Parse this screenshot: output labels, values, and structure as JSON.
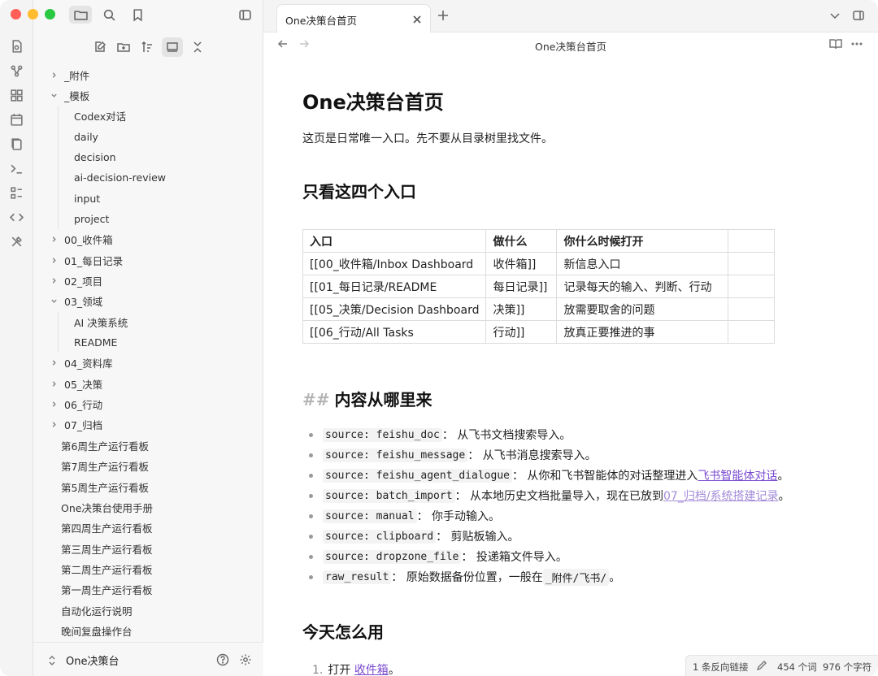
{
  "sidebar": {
    "tree": [
      {
        "label": "_附件",
        "kind": "folder",
        "expanded": false
      },
      {
        "label": "_模板",
        "kind": "folder",
        "expanded": true
      },
      {
        "label": "Codex对话",
        "kind": "file",
        "depth": 1
      },
      {
        "label": "daily",
        "kind": "file",
        "depth": 1
      },
      {
        "label": "decision",
        "kind": "file",
        "depth": 1
      },
      {
        "label": "ai-decision-review",
        "kind": "file",
        "depth": 1
      },
      {
        "label": "input",
        "kind": "file",
        "depth": 1
      },
      {
        "label": "project",
        "kind": "file",
        "depth": 1
      },
      {
        "label": "00_收件箱",
        "kind": "folder",
        "expanded": false
      },
      {
        "label": "01_每日记录",
        "kind": "folder",
        "expanded": false
      },
      {
        "label": "02_项目",
        "kind": "folder",
        "expanded": false
      },
      {
        "label": "03_领域",
        "kind": "folder",
        "expanded": true
      },
      {
        "label": "AI 决策系统",
        "kind": "file",
        "depth": 1
      },
      {
        "label": "README",
        "kind": "file",
        "depth": 1
      },
      {
        "label": "04_资料库",
        "kind": "folder",
        "expanded": false
      },
      {
        "label": "05_决策",
        "kind": "folder",
        "expanded": false
      },
      {
        "label": "06_行动",
        "kind": "folder",
        "expanded": false
      },
      {
        "label": "07_归档",
        "kind": "folder",
        "expanded": false
      },
      {
        "label": "第6周生产运行看板",
        "kind": "file",
        "depth": 0
      },
      {
        "label": "第7周生产运行看板",
        "kind": "file",
        "depth": 0
      },
      {
        "label": "第5周生产运行看板",
        "kind": "file",
        "depth": 0
      },
      {
        "label": "One决策台使用手册",
        "kind": "file",
        "depth": 0
      },
      {
        "label": "第四周生产运行看板",
        "kind": "file",
        "depth": 0
      },
      {
        "label": "第三周生产运行看板",
        "kind": "file",
        "depth": 0
      },
      {
        "label": "第二周生产运行看板",
        "kind": "file",
        "depth": 0
      },
      {
        "label": "第一周生产运行看板",
        "kind": "file",
        "depth": 0
      },
      {
        "label": "自动化运行说明",
        "kind": "file",
        "depth": 0
      },
      {
        "label": "晚间复盘操作台",
        "kind": "file",
        "depth": 0
      }
    ],
    "vault_name": "One决策台"
  },
  "tabs": [
    {
      "label": "One决策台首页",
      "active": true
    }
  ],
  "nav": {
    "title": "One决策台首页"
  },
  "doc": {
    "title": "One决策台首页",
    "intro": "这页是日常唯一入口。先不要从目录树里找文件。",
    "h_entries": "只看这四个入口",
    "table": {
      "headers": [
        "入口",
        "做什么",
        "你什么时候打开",
        ""
      ],
      "rows": [
        [
          "[[00_收件箱/Inbox Dashboard",
          "收件箱]]",
          "新信息入口",
          ""
        ],
        [
          "[[01_每日记录/README",
          "每日记录]]",
          "记录每天的输入、判断、行动",
          ""
        ],
        [
          "[[05_决策/Decision Dashboard",
          "决策]]",
          "放需要取舍的问题",
          ""
        ],
        [
          "[[06_行动/All Tasks",
          "行动]]",
          "放真正要推进的事",
          ""
        ]
      ]
    },
    "h_source_hashes": "##",
    "h_source": "内容从哪里来",
    "bullets": [
      {
        "code": "source: feishu_doc",
        "text": "： 从飞书文档搜索导入。"
      },
      {
        "code": "source: feishu_message",
        "text": "： 从飞书消息搜索导入。"
      },
      {
        "code": "source: feishu_agent_dialogue",
        "text": "： 从你和飞书智能体的对话整理进入 ",
        "link": "飞书智能体对话",
        "link_style": "strong",
        "tail": "。"
      },
      {
        "code": "source: batch_import",
        "text": "： 从本地历史文档批量导入，现在已放到 ",
        "link": "07_归档/系统搭建记录",
        "link_style": "faint",
        "tail": "。"
      },
      {
        "code": "source: manual",
        "text": "： 你手动输入。"
      },
      {
        "code": "source: clipboard",
        "text": "： 剪贴板输入。"
      },
      {
        "code": "source: dropzone_file",
        "text": "： 投递箱文件导入。"
      },
      {
        "code": "raw_result",
        "text": "： 原始数据备份位置，一般在 ",
        "code2": "_附件/飞书/",
        "tail": " 。"
      }
    ],
    "h_today": "今天怎么用",
    "steps": [
      {
        "num": "1.",
        "text": "打开 ",
        "link": "收件箱",
        "tail": "。"
      }
    ]
  },
  "status": {
    "backlinks": "1 条反向链接",
    "words": "454 个词",
    "chars": "976 个字符"
  }
}
